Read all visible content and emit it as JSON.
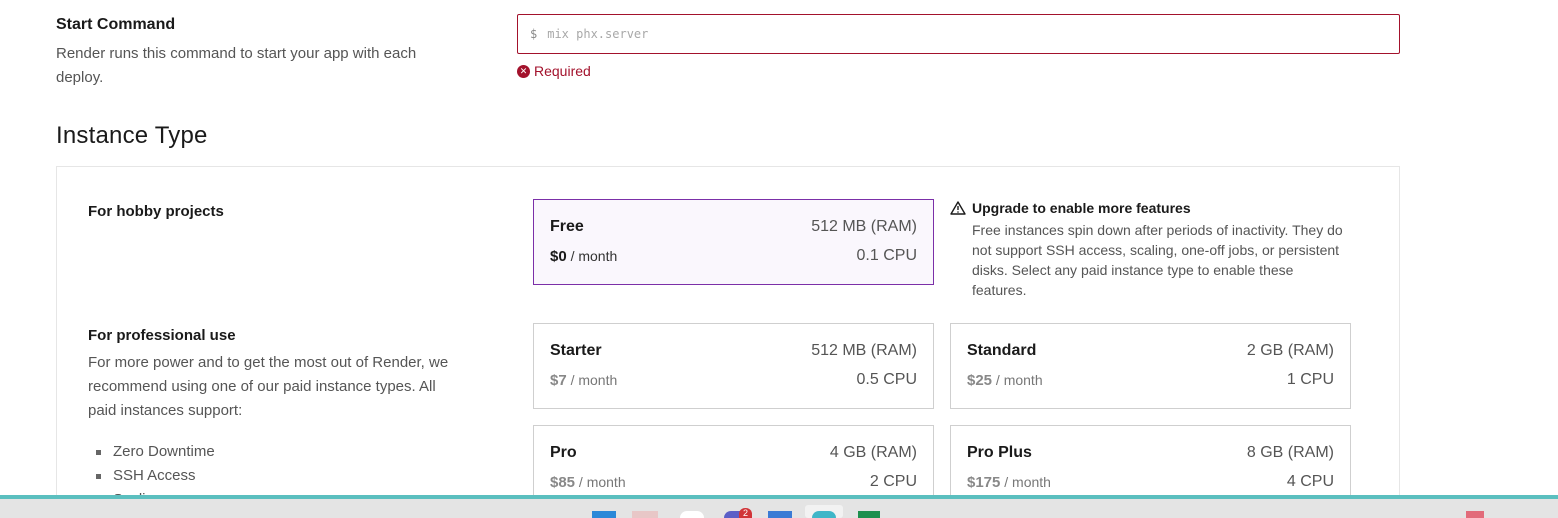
{
  "start_command": {
    "title": "Start Command",
    "description": "Render runs this command to start your app with each deploy.",
    "prompt": "$",
    "placeholder": "mix phx.server",
    "error": "Required"
  },
  "instance_type": {
    "title": "Instance Type",
    "hobby": {
      "title": "For hobby projects",
      "plans": [
        {
          "name": "Free",
          "ram": "512 MB (RAM)",
          "price": "$0",
          "period": "/ month",
          "cpu": "0.1 CPU",
          "selected": true
        }
      ]
    },
    "upgrade": {
      "title": "Upgrade to enable more features",
      "text": "Free instances spin down after periods of inactivity. They do not support SSH access, scaling, one-off jobs, or persistent disks. Select any paid instance type to enable these features."
    },
    "professional": {
      "title": "For professional use",
      "description": "For more power and to get the most out of Render, we recommend using one of our paid instance types. All paid instances support:",
      "features": [
        "Zero Downtime",
        "SSH Access",
        "Scaling"
      ],
      "plans": [
        {
          "name": "Starter",
          "ram": "512 MB (RAM)",
          "price": "$7",
          "period": "/ month",
          "cpu": "0.5 CPU"
        },
        {
          "name": "Standard",
          "ram": "2 GB (RAM)",
          "price": "$25",
          "period": "/ month",
          "cpu": "1 CPU"
        },
        {
          "name": "Pro",
          "ram": "4 GB (RAM)",
          "price": "$85",
          "period": "/ month",
          "cpu": "2 CPU"
        },
        {
          "name": "Pro Plus",
          "ram": "8 GB (RAM)",
          "price": "$175",
          "period": "/ month",
          "cpu": "4 CPU"
        }
      ]
    }
  },
  "taskbar": {
    "notification_badge": "2"
  },
  "colors": {
    "error": "#a3122c",
    "selected_border": "#7b2fa8",
    "taskbar_accent": "#5bbfbf"
  }
}
